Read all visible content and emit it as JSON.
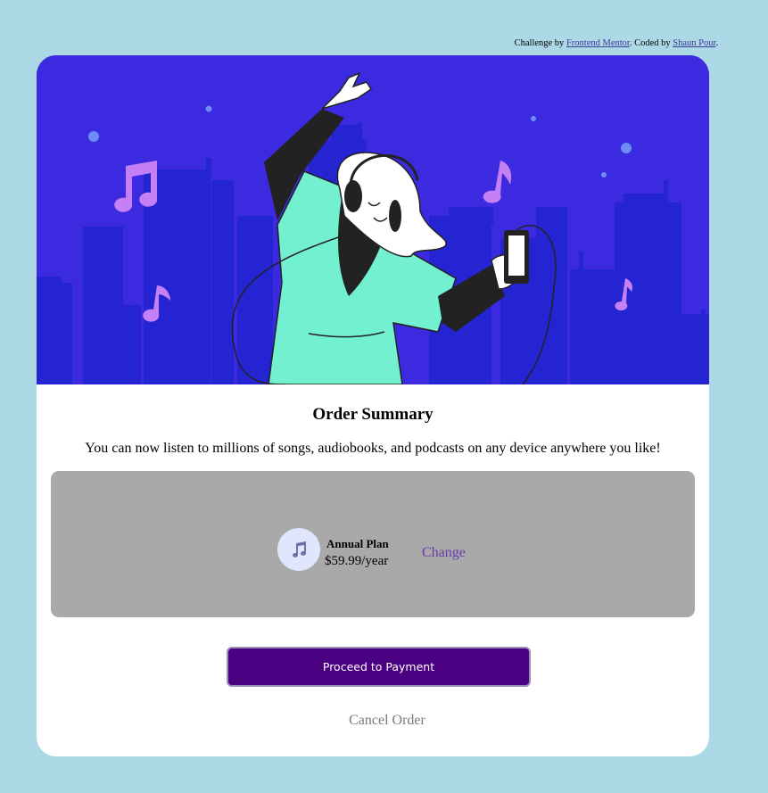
{
  "attribution": {
    "prefix": "Challenge by ",
    "link1": "Frontend Mentor",
    "middle": ". Coded by ",
    "link2": "Shaun Pour",
    "suffix": "."
  },
  "card": {
    "title": "Order Summary",
    "description": "You can now listen to millions of songs, audiobooks, and podcasts on any device anywhere you like!",
    "plan": {
      "icon": "music-note-icon",
      "name": "Annual Plan",
      "price": "$59.99/year",
      "change_label": "Change"
    },
    "pay_label": "Proceed to Payment",
    "cancel_label": "Cancel Order"
  },
  "colors": {
    "background": "#add8e6",
    "hero": "#3b2ae0",
    "plan_box": "#a9a9a9",
    "pay_button": "#4b0082",
    "change_link": "#6a3aa6"
  }
}
